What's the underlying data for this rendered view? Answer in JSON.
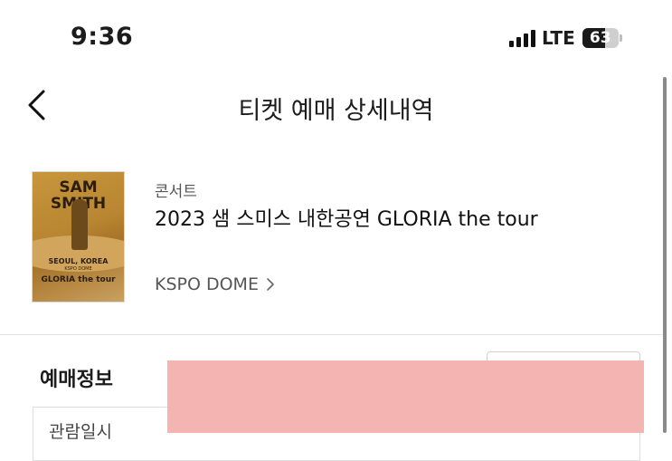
{
  "status_bar": {
    "time": "9:36",
    "network": "LTE",
    "battery": "63",
    "battery_level": 0.63,
    "signal_bars": 4
  },
  "header": {
    "title": "티켓 예매 상세내역",
    "back_icon": "chevron-left-icon"
  },
  "event": {
    "category": "콘서트",
    "title": "2023 샘 스미스 내한공연 GLORIA the tour",
    "venue": "KSPO DOME",
    "venue_icon": "chevron-right-icon",
    "poster": {
      "line1": "SAM",
      "line2": "SMITH",
      "city": "SEOUL, KOREA",
      "venue": "KSPO DOME",
      "tour": "GLORIA the tour"
    }
  },
  "booking": {
    "section_title": "예매정보",
    "first_row_label": "관람일시"
  },
  "colors": {
    "redaction": "#f4b4b1",
    "text_primary": "#111111",
    "text_secondary": "#555555"
  }
}
